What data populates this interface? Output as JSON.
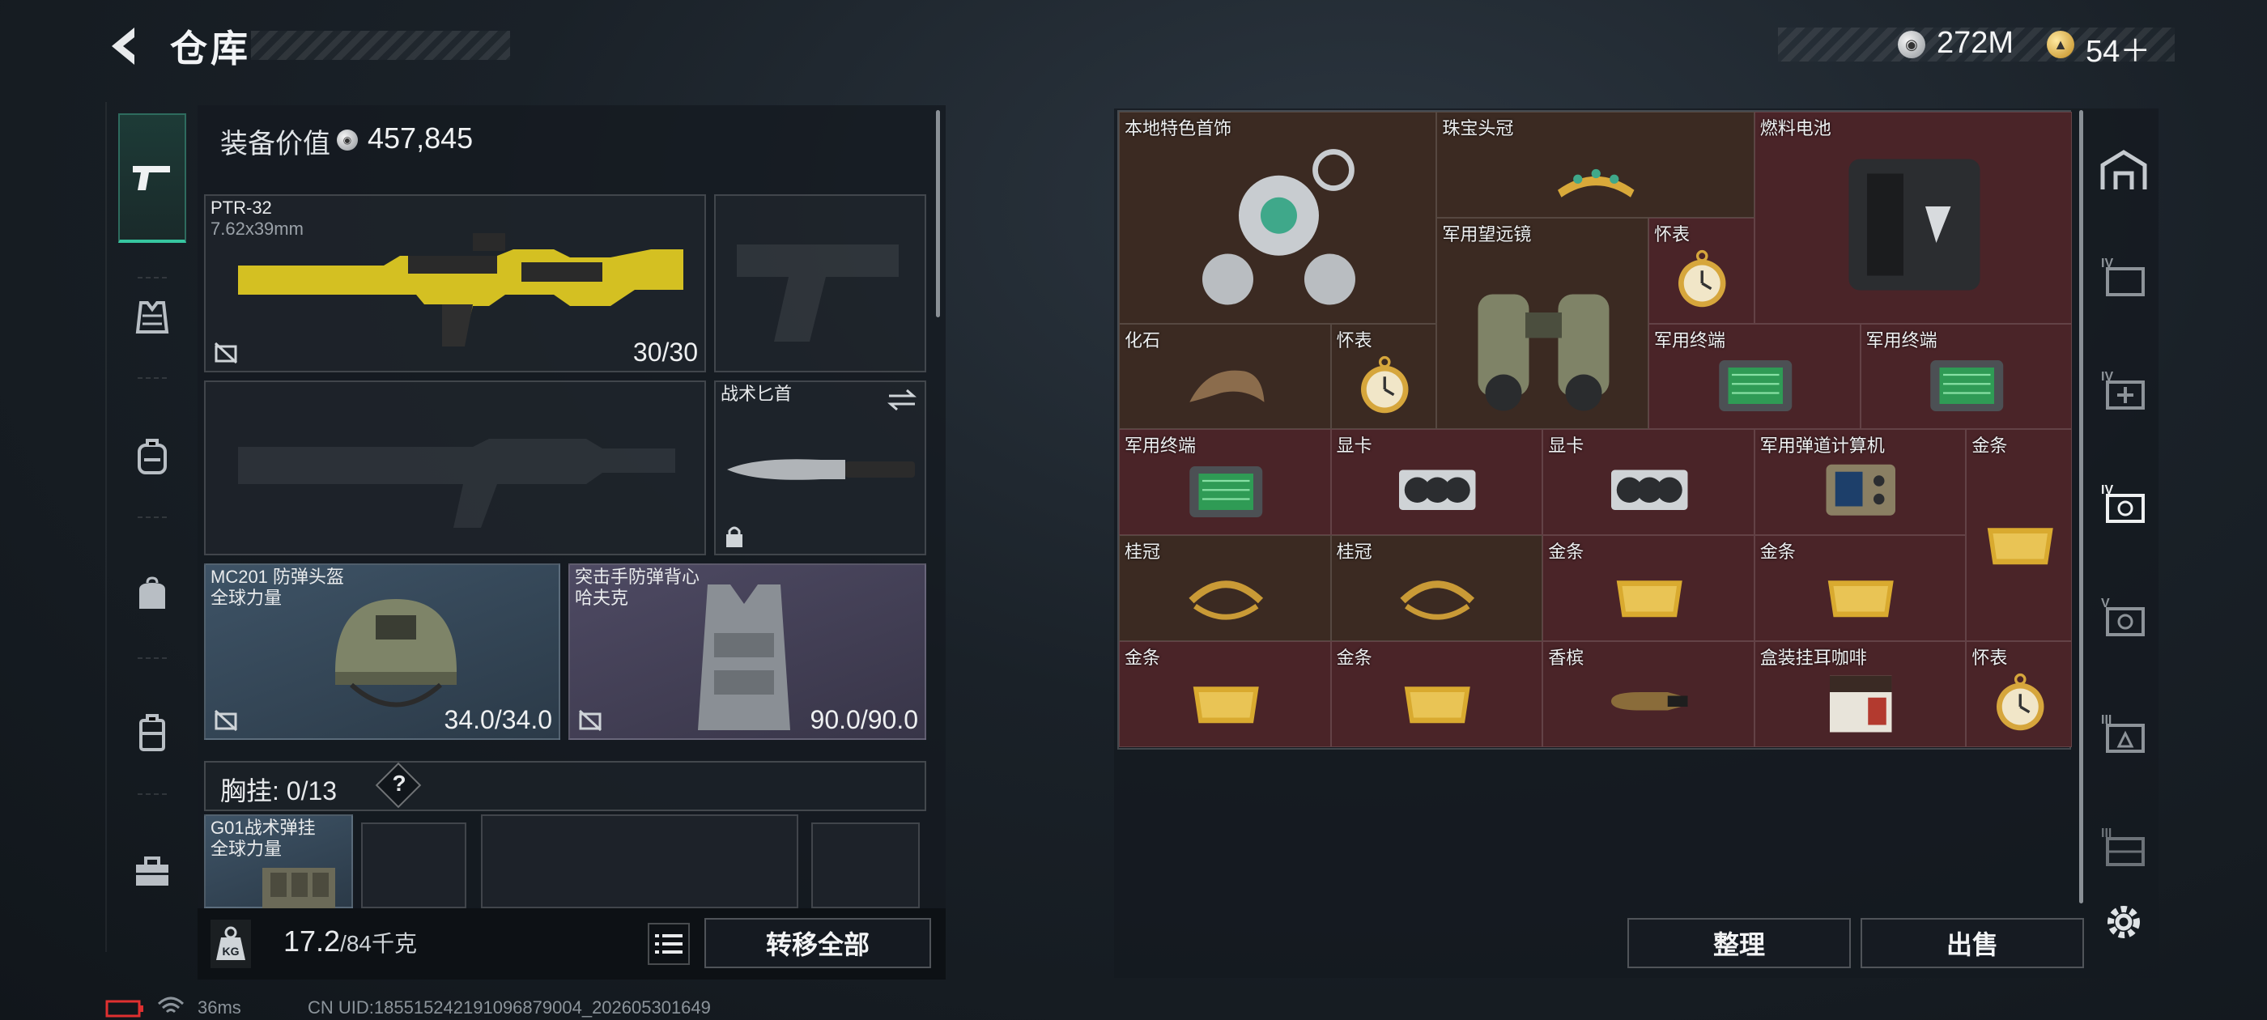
{
  "header": {
    "title": "仓库",
    "silver_amount": "272M",
    "gold_amount": "54＋"
  },
  "left": {
    "equip_label": "装备价值",
    "equip_value": "457,845",
    "primary": {
      "name": "PTR-32",
      "caliber": "7.62x39mm",
      "ammo": "30/30"
    },
    "knife": {
      "label": "战术匕首"
    },
    "helmet": {
      "name": "MC201 防弹头盔",
      "sub": "全球力量",
      "durability": "34.0/34.0"
    },
    "vest": {
      "name": "突击手防弹背心",
      "sub": "哈夫克",
      "durability": "90.0/90.0"
    },
    "chest_label": "胸挂:",
    "chest_count": "0/13",
    "help": "?",
    "rig": {
      "name": "G01战术弹挂",
      "sub": "全球力量"
    },
    "weight": "17.2",
    "weight_max": "/84千克",
    "transfer_all": "转移全部"
  },
  "items": [
    {
      "label": "本地特色首饰",
      "icon": "jewelry-icon",
      "bg": "brown"
    },
    {
      "label": "珠宝头冠",
      "icon": "tiara-icon",
      "bg": "brown"
    },
    {
      "label": "燃料电池",
      "icon": "fuel-cell-icon",
      "bg": "red"
    },
    {
      "label": "军用望远镜",
      "icon": "binoculars-icon",
      "bg": "brown"
    },
    {
      "label": "怀表",
      "icon": "pocket-watch-icon",
      "bg": "red"
    },
    {
      "label": "化石",
      "icon": "fossil-icon",
      "bg": "brown"
    },
    {
      "label": "怀表",
      "icon": "pocket-watch-icon",
      "bg": "brown"
    },
    {
      "label": "军用终端",
      "icon": "terminal-icon",
      "bg": "red"
    },
    {
      "label": "军用终端",
      "icon": "terminal-icon",
      "bg": "red"
    },
    {
      "label": "军用终端",
      "icon": "terminal-icon",
      "bg": "red"
    },
    {
      "label": "显卡",
      "icon": "gpu-icon",
      "bg": "red"
    },
    {
      "label": "显卡",
      "icon": "gpu-icon",
      "bg": "red"
    },
    {
      "label": "军用弹道计算机",
      "icon": "ballistic-computer-icon",
      "bg": "red"
    },
    {
      "label": "金条",
      "icon": "gold-bar-icon",
      "bg": "red"
    },
    {
      "label": "桂冠",
      "icon": "laurel-icon",
      "bg": "brown"
    },
    {
      "label": "桂冠",
      "icon": "laurel-icon",
      "bg": "brown"
    },
    {
      "label": "金条",
      "icon": "gold-bar-icon",
      "bg": "red"
    },
    {
      "label": "金条",
      "icon": "gold-bar-icon",
      "bg": "red"
    },
    {
      "label": "金条",
      "icon": "gold-bar-icon",
      "bg": "red"
    },
    {
      "label": "金条",
      "icon": "gold-bar-icon",
      "bg": "red"
    },
    {
      "label": "香槟",
      "icon": "champagne-icon",
      "bg": "red"
    },
    {
      "label": "盒装挂耳咖啡",
      "icon": "coffee-box-icon",
      "bg": "red"
    },
    {
      "label": "怀表",
      "icon": "pocket-watch-icon",
      "bg": "red"
    }
  ],
  "actions": {
    "sort": "整理",
    "sell": "出售"
  },
  "status": {
    "ping": "36ms",
    "uid": "CN UID:18551524219109687900​4_202605301649"
  }
}
